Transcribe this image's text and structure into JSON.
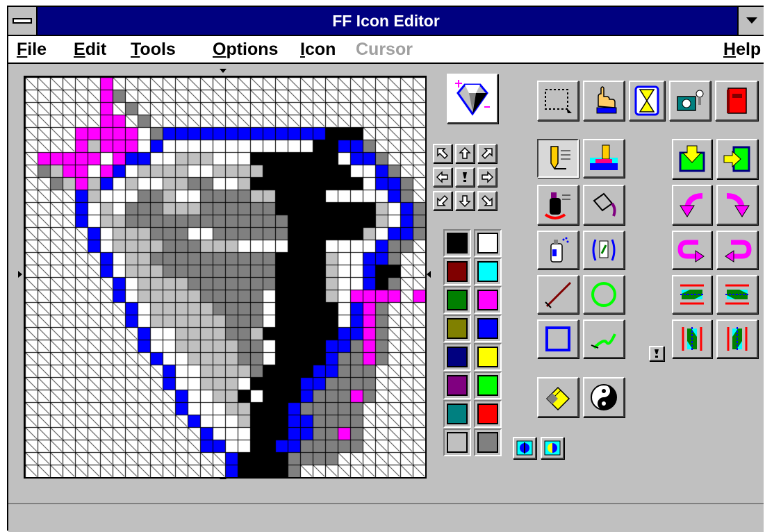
{
  "window": {
    "title": "FF Icon Editor"
  },
  "menu": {
    "file": {
      "first": "F",
      "rest": "ile"
    },
    "edit": {
      "first": "E",
      "rest": "dit"
    },
    "tools": {
      "first": "T",
      "rest": "ools"
    },
    "options": {
      "first": "O",
      "rest": "ptions"
    },
    "icon": {
      "first": "I",
      "rest": "con"
    },
    "cursor": {
      "label": "Cursor",
      "disabled": true
    },
    "help": {
      "first": "H",
      "rest": "elp"
    }
  },
  "status": {
    "text": ""
  },
  "palette": {
    "colors": [
      "#000000",
      "#ffffff",
      "#800000",
      "#00ffff",
      "#008000",
      "#ff00ff",
      "#808000",
      "#0000ff",
      "#000080",
      "#ffff00",
      "#800080",
      "#00ff00",
      "#008080",
      "#ff0000",
      "#c0c0c0",
      "#808080"
    ]
  },
  "icon_canvas": {
    "size": 32,
    "legend": {
      ".": "transparent",
      "W": "#ffffff",
      "L": "#c0c0c0",
      "D": "#808080",
      "K": "#000000",
      "B": "#0000ff",
      "M": "#ff00ff"
    },
    "rows": [
      "......M.........................",
      "......MD........................",
      "......M.D.......................",
      "......MM.D......................",
      "....MMMMMWDBBBBBBBBBBBBBKKK.....",
      "....MLMMMWBWWWWWWWWWWWWKKBBD....",
      ".MMMMMWMBBWWLLLWWWKKKKKKKWBBD...",
      ".DLMMWMBWLLLLWWLLLLKKKKKKKWWBD..",
      "..DLMLBWLWWLLDDWWLKKKKKKKKKWBBD.",
      "....BLWWWDDLWWDDDDLLKKKKWWWWWBD.",
      "....BWLWDDDLLLDDDDDDKKKKKKKKLWBD",
      "....BWLLDDDDDDDDDDDDDKKKKKKKLWBD",
      ".....BWLLLDDDWWDDDDDDKKKKKKLWBBD",
      ".....BWLLLLDDDLLLWWWWKKKWWWWBDD.",
      "......BWLLDDDDDDDDDDKKKKLWWBBD..",
      "......BWLLLDDDDDDDDDKKKKLWWBKK..",
      ".......BWLLLLDDDDDDDKKKKLWWBKD..",
      ".......BWLLLLLDDDDDWKKKKLWMMMM.M",
      "........BWLLLLLDDDDWKKKKKWBMD...",
      "........BWLLLLLLDDDWKKKKKWBMD...",
      ".........BWWLLLLDDLKKKKKKBBMD...",
      ".........BWWLLLLLDDWKKKKBBDMD...",
      "..........BWWLLLLDDWKKKKBDDMD...",
      "...........BWWLLLLDKKKKBBDDD....",
      "...........BWWLLLWKKKKBBDDDD....",
      "............BWWLLKWKKKBDDDMD....",
      "............BWWWLLKKKBDDDDD.....",
      ".............BWWWLKKKBBDDDD.....",
      "..............BWWWKKKBBDDMD.....",
      "..............BBWWKKBBDDDDD.....",
      "................BKKKKDDDD.......",
      "................BKKKKD.........."
    ]
  }
}
